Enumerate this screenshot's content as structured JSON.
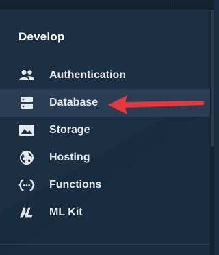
{
  "sidebar": {
    "section_title": "Develop",
    "items": [
      {
        "label": "Authentication",
        "icon": "people-icon",
        "active": false
      },
      {
        "label": "Database",
        "icon": "database-icon",
        "active": true
      },
      {
        "label": "Storage",
        "icon": "image-icon",
        "active": false
      },
      {
        "label": "Hosting",
        "icon": "globe-icon",
        "active": false
      },
      {
        "label": "Functions",
        "icon": "functions-icon",
        "active": false
      },
      {
        "label": "ML Kit",
        "icon": "ml-kit-icon",
        "active": false
      }
    ]
  },
  "annotation": {
    "icon": "red-arrow-icon",
    "color": "#e8363d"
  },
  "colors": {
    "background": "#1c2f43",
    "active_row": "#2a3e53",
    "text": "#e4e9ee",
    "icon": "#e4e9ee"
  }
}
